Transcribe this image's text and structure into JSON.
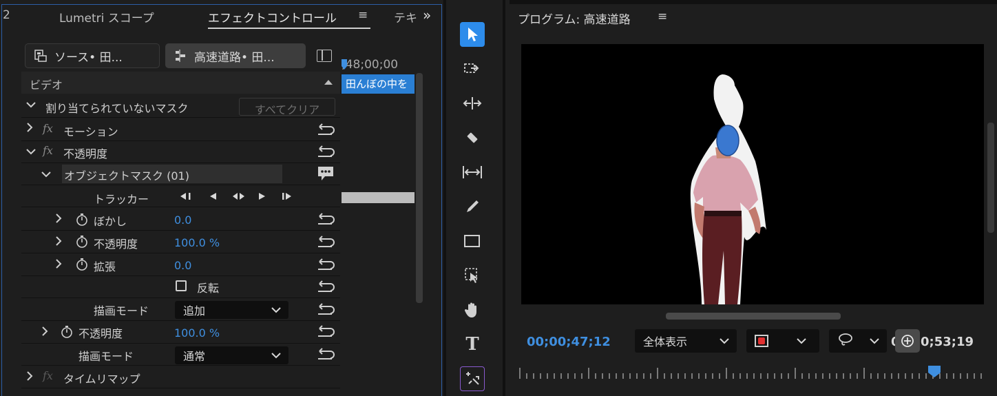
{
  "left_panel": {
    "tab_number": "2",
    "tabs": [
      "Lumetri スコープ",
      "エフェクトコントロール",
      "テキ"
    ],
    "menu_glyph": "≡",
    "overflow_glyph": "»",
    "source_button": "ソース• 田...",
    "sequence_button": "高速道路• 田...",
    "timeline_timecode": ";48;00;00",
    "clip_label": "田んぼの中を",
    "section_video": "ビデオ",
    "unassigned_mask": "割り当てられていないマスク",
    "clear_all": "すべてクリア",
    "motion": "モーション",
    "opacity": "不透明度",
    "object_mask": "オブジェクトマスク (01)",
    "tracker": "トラッカー",
    "blur": {
      "label": "ぼかし",
      "value": "0.0"
    },
    "mask_opacity": {
      "label": "不透明度",
      "value": "100.0 %"
    },
    "expansion": {
      "label": "拡張",
      "value": "0.0"
    },
    "invert": "反転",
    "blend_mode_label_1": "描画モード",
    "blend_mode_value_1": "追加",
    "opacity2": {
      "label": "不透明度",
      "value": "100.0 %"
    },
    "blend_mode_label_2": "描画モード",
    "blend_mode_value_2": "通常",
    "time_remap": "タイムリマップ",
    "fx_glyph": "fx"
  },
  "toolbar": {
    "tools": [
      "selection-tool",
      "track-select-tool",
      "ripple-edit-tool",
      "razor-tool",
      "slip-tool",
      "pen-tool",
      "rectangle-tool",
      "hand-tool-select",
      "hand-tool",
      "type-tool",
      "generative-tool"
    ],
    "type_glyph": "T"
  },
  "program_monitor": {
    "title": "プログラム: 高速道路",
    "menu_glyph": "≡",
    "current_timecode": "00;00;47;12",
    "zoom": "全体表示",
    "duration_timecode": "0;53;19",
    "duration_prefix": "0"
  },
  "colors": {
    "accent_blue": "#3f8fe0",
    "selection_tool_bg": "#2d8ceb",
    "panel_bg": "#1e1e1e"
  }
}
